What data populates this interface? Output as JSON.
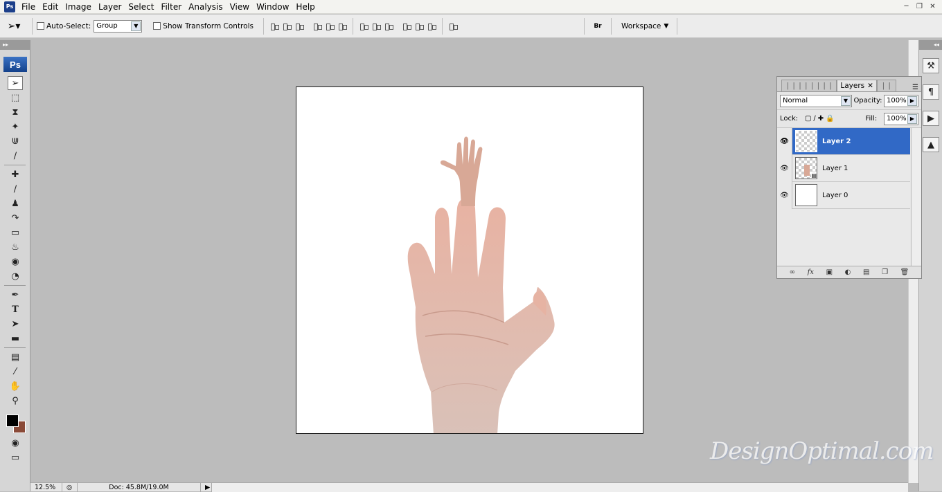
{
  "menubar": {
    "app_icon": "Ps",
    "items": [
      "File",
      "Edit",
      "Image",
      "Layer",
      "Select",
      "Filter",
      "Analysis",
      "View",
      "Window",
      "Help"
    ]
  },
  "options": {
    "auto_select_label": "Auto-Select:",
    "auto_select_value": "Group",
    "show_transform_label": "Show Transform Controls",
    "workspace_label": "Workspace"
  },
  "toolbox": {
    "logo": "Ps",
    "text_tool": "T"
  },
  "layers_panel": {
    "tab_label": "Layers",
    "blend_mode": "Normal",
    "opacity_label": "Opacity:",
    "opacity_value": "100%",
    "lock_label": "Lock:",
    "fill_label": "Fill:",
    "fill_value": "100%",
    "layers": [
      {
        "name": "Layer 2",
        "selected": true
      },
      {
        "name": "Layer 1",
        "selected": false
      },
      {
        "name": "Layer 0",
        "selected": false
      }
    ]
  },
  "statusbar": {
    "zoom": "12.5%",
    "doc_info": "Doc: 45.8M/19.0M"
  },
  "watermark": "DesignOptimal.com",
  "colors": {
    "foreground": "#000000",
    "background": "#8a4a38",
    "selection": "#3169c6"
  }
}
